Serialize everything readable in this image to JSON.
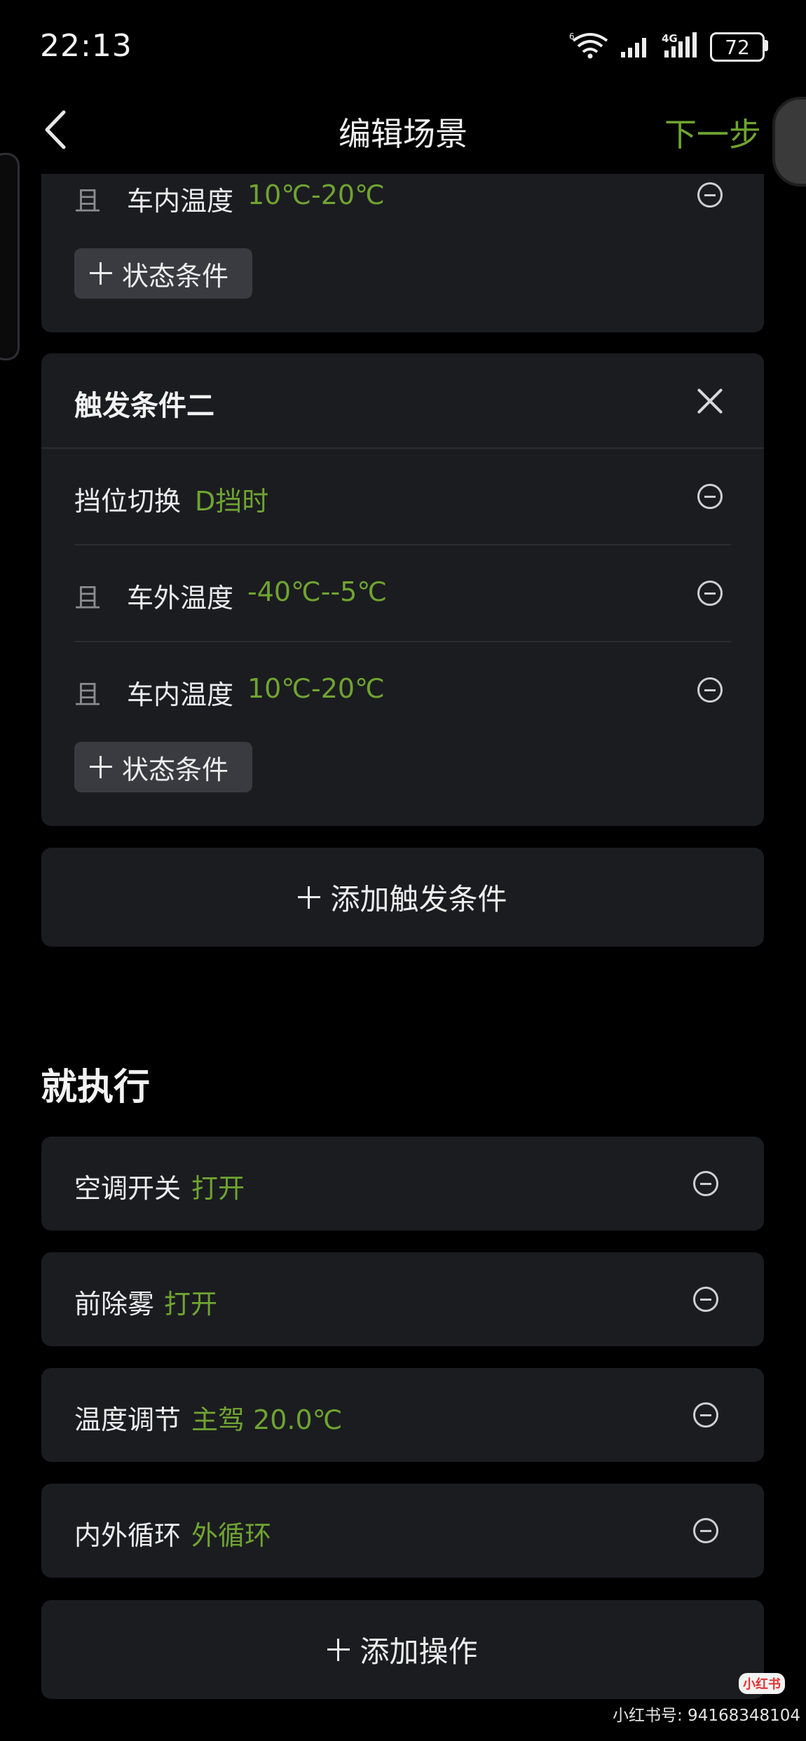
{
  "status_bar": {
    "time": "22:13",
    "battery": "72",
    "network": "4G"
  },
  "header": {
    "title": "编辑场景",
    "next_label": "下一步"
  },
  "trigger_one_tail": {
    "rows": [
      {
        "prefix": "且",
        "label": "车内温度",
        "value": "10℃-20℃"
      }
    ],
    "add_state_label": "状态条件"
  },
  "trigger_two": {
    "title": "触发条件二",
    "rows": [
      {
        "prefix": "",
        "label": "挡位切换",
        "value": "D挡时"
      },
      {
        "prefix": "且",
        "label": "车外温度",
        "value": "-40℃--5℃"
      },
      {
        "prefix": "且",
        "label": "车内温度",
        "value": "10℃-20℃"
      }
    ],
    "add_state_label": "状态条件"
  },
  "add_trigger_label": "添加触发条件",
  "execute": {
    "title": "就执行",
    "actions": [
      {
        "label": "空调开关",
        "value": "打开"
      },
      {
        "label": "前除雾",
        "value": "打开"
      },
      {
        "label": "温度调节",
        "value": "主驾 20.0℃"
      },
      {
        "label": "内外循环",
        "value": "外循环"
      }
    ],
    "add_action_label": "添加操作"
  },
  "watermark": {
    "logo": "小红书",
    "text": "小红书号: 94168348104"
  },
  "colors": {
    "accent_green": "#6fa431",
    "card_bg": "#1b1c20",
    "page_bg": "#000000"
  }
}
